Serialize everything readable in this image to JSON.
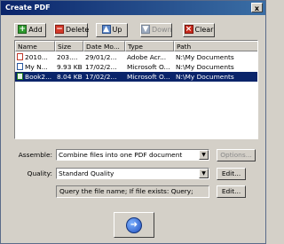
{
  "window": {
    "title": "Create PDF",
    "close_label": "x"
  },
  "toolbar": {
    "add": {
      "label": "Add",
      "icon": "plus-icon"
    },
    "delete": {
      "label": "Delete",
      "icon": "minus-icon"
    },
    "up": {
      "label": "Up",
      "icon": "arrow-up-icon"
    },
    "down": {
      "label": "Down",
      "icon": "arrow-down-icon"
    },
    "clear": {
      "label": "Clear",
      "icon": "clear-icon"
    }
  },
  "list": {
    "columns": [
      "Name",
      "Size",
      "Date Mo...",
      "Type",
      "Path"
    ],
    "rows": [
      {
        "name": "2010...",
        "size": "203....",
        "date": "29/01/2...",
        "type": "Adobe Acr...",
        "path": "N:\\My Documents",
        "icon": "pdf-file-icon",
        "selected": false
      },
      {
        "name": "My N...",
        "size": "9.93 KB",
        "date": "17/02/2...",
        "type": "Microsoft O...",
        "path": "N:\\My Documents",
        "icon": "word-file-icon",
        "selected": false
      },
      {
        "name": "Book2...",
        "size": "8.04 KB",
        "date": "17/02/2...",
        "type": "Microsoft O...",
        "path": "N:\\My Documents",
        "icon": "excel-file-icon",
        "selected": true
      }
    ]
  },
  "assemble": {
    "label": "Assemble:",
    "value": "Combine files into one PDF document",
    "options_button": "Options..."
  },
  "quality": {
    "label": "Quality:",
    "value": "Standard Quality",
    "edit_button": "Edit..."
  },
  "naming": {
    "value": "Query the file name; If file exists: Query;",
    "edit_button": "Edit..."
  },
  "convert": {
    "icon": "convert-arrow-icon",
    "glyph": "➜"
  }
}
